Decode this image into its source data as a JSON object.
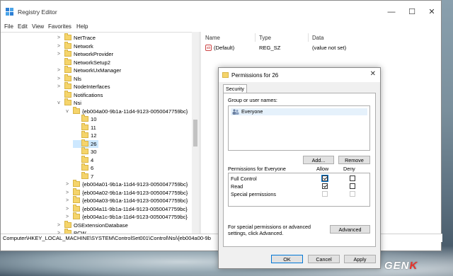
{
  "window": {
    "title": "Registry Editor",
    "controls": {
      "minimize": "—",
      "maximize": "☐",
      "close": "✕"
    }
  },
  "menu": [
    "File",
    "Edit",
    "View",
    "Favorites",
    "Help"
  ],
  "tree": [
    {
      "label": "NetTrace",
      "expander": ">"
    },
    {
      "label": "Network",
      "expander": ">"
    },
    {
      "label": "NetworkProvider",
      "expander": ">"
    },
    {
      "label": "NetworkSetup2",
      "expander": ""
    },
    {
      "label": "NetworkUxManager",
      "expander": ">"
    },
    {
      "label": "Nls",
      "expander": ">"
    },
    {
      "label": "NodeInterfaces",
      "expander": ">"
    },
    {
      "label": "Notifications",
      "expander": ""
    },
    {
      "label": "Nsi",
      "expander": "v"
    },
    {
      "label": "{eb004a00-9b1a-11d4-9123-0050047759bc}",
      "expander": "v"
    },
    {
      "label": "10",
      "expander": ""
    },
    {
      "label": "11",
      "expander": ""
    },
    {
      "label": "12",
      "expander": ""
    },
    {
      "label": "26",
      "expander": "",
      "selected": true
    },
    {
      "label": "30",
      "expander": ""
    },
    {
      "label": "4",
      "expander": ""
    },
    {
      "label": "6",
      "expander": ""
    },
    {
      "label": "7",
      "expander": ""
    },
    {
      "label": "{eb004a01-9b1a-11d4-9123-0050047759bc}",
      "expander": ">"
    },
    {
      "label": "{eb004a02-9b1a-11d4-9123-0050047759bc}",
      "expander": ">"
    },
    {
      "label": "{eb004a03-9b1a-11d4-9123-0050047759bc}",
      "expander": ">"
    },
    {
      "label": "{eb004a11-9b1a-11d4-9123-0050047759bc}",
      "expander": ">"
    },
    {
      "label": "{eb004a1c-9b1a-11d4-9123-0050047759bc}",
      "expander": ">"
    },
    {
      "label": "OSExtensionDatabase",
      "expander": ">"
    },
    {
      "label": "PCW",
      "expander": ">"
    }
  ],
  "values_pane": {
    "headers": {
      "name": "Name",
      "type": "Type",
      "data": "Data"
    },
    "rows": [
      {
        "icon": "ab",
        "name": "(Default)",
        "type": "REG_SZ",
        "data": "(value not set)"
      }
    ]
  },
  "status_bar": "Computer\\HKEY_LOCAL_MACHINE\\SYSTEM\\ControlSet001\\Control\\Nsi\\{eb004a00-9b",
  "dialog": {
    "title": "Permissions for 26",
    "close": "✕",
    "tab": "Security",
    "group_label": "Group or user names:",
    "users": [
      "Everyone"
    ],
    "add_button": "Add...",
    "remove_button": "Remove",
    "permissions_label": "Permissions for Everyone",
    "allow_label": "Allow",
    "deny_label": "Deny",
    "permissions": [
      {
        "name": "Full Control",
        "allow": true,
        "deny": false
      },
      {
        "name": "Read",
        "allow": true,
        "deny": false
      },
      {
        "name": "Special permissions",
        "allow": false,
        "deny": false
      }
    ],
    "advanced_text": "For special permissions or advanced settings, click Advanced.",
    "advanced_button": "Advanced",
    "ok_button": "OK",
    "cancel_button": "Cancel",
    "apply_button": "Apply"
  },
  "watermark": {
    "prefix": "GEN",
    "highlight": "K"
  },
  "colors": {
    "folder": "#f5d46b",
    "selection": "#cde8ff",
    "accent": "#0078d7"
  }
}
